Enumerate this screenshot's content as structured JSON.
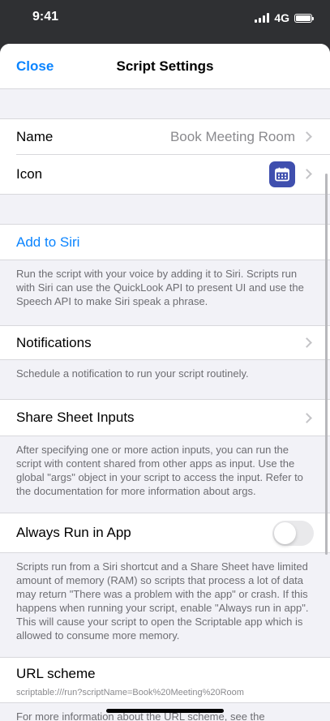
{
  "status": {
    "time": "9:41",
    "network": "4G"
  },
  "navbar": {
    "close_label": "Close",
    "title": "Script Settings"
  },
  "general": {
    "name_label": "Name",
    "name_value": "Book Meeting Room",
    "icon_label": "Icon",
    "icon_color": "#3f4fae"
  },
  "siri": {
    "add_label": "Add to Siri",
    "footer": "Run the script with your voice by adding it to Siri. Scripts run with Siri can use the QuickLook API to present UI and use the Speech API to make Siri speak a phrase."
  },
  "notifications": {
    "label": "Notifications",
    "footer": "Schedule a notification to run your script routinely."
  },
  "share_sheet": {
    "label": "Share Sheet Inputs",
    "footer": "After specifying one or more action inputs, you can run the script with content shared from other apps as input. Use the global \"args\" object in your script to access the input. Refer to the documentation for more information about args."
  },
  "always_run": {
    "label": "Always Run in App",
    "enabled": false,
    "footer": "Scripts run from a Siri shortcut and a Share Sheet have limited amount of memory (RAM) so scripts that process a lot of data may return \"There was a problem with the app\" or crash. If this happens when running your script, enable \"Always run in app\". This will cause your script to open the Scriptable app which is allowed to consume more memory."
  },
  "url_scheme": {
    "label": "URL scheme",
    "value": "scriptable:///run?scriptName=Book%20Meeting%20Room",
    "footer": "For more information about the URL scheme, see the documentation."
  },
  "colors": {
    "accent": "#0a84ff",
    "secondary_text": "#6d6d72"
  }
}
